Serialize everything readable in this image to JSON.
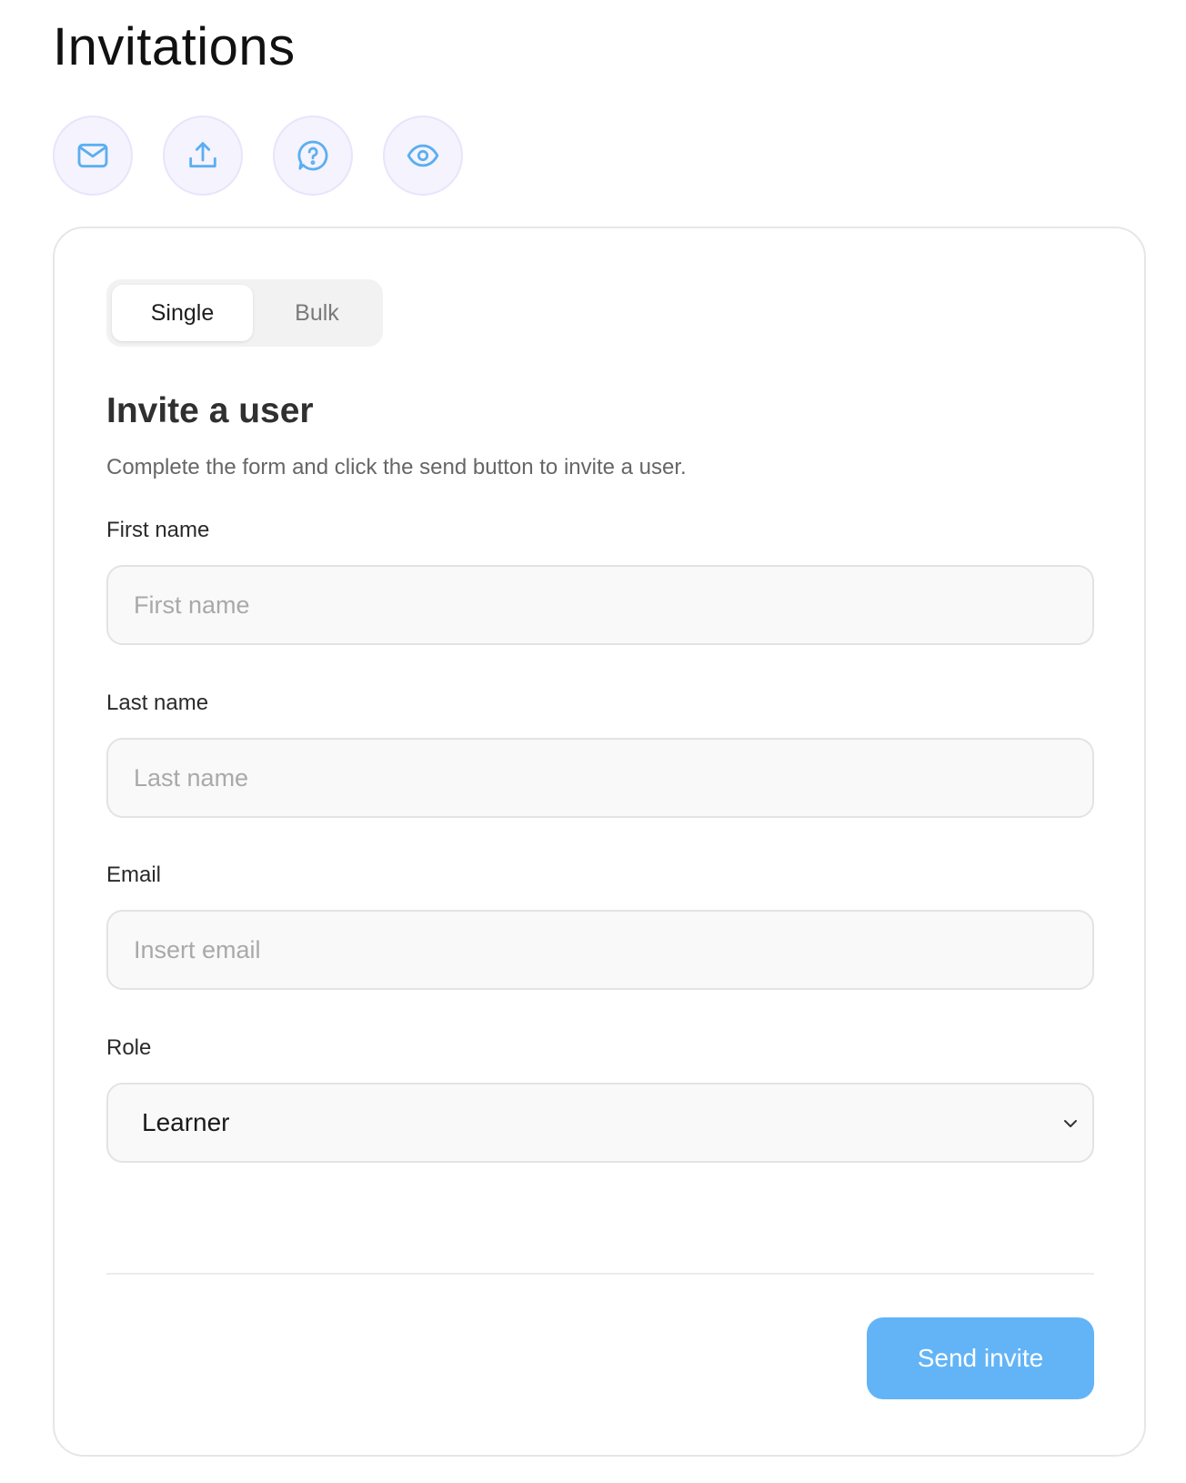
{
  "page": {
    "title": "Invitations"
  },
  "toolbar": {
    "icons": [
      {
        "name": "mail-icon"
      },
      {
        "name": "upload-icon"
      },
      {
        "name": "help-icon"
      },
      {
        "name": "eye-icon"
      }
    ],
    "icon_color": "#5aaff0",
    "icon_bg": "#f5f3fe"
  },
  "tabs": {
    "single_label": "Single",
    "bulk_label": "Bulk",
    "active": "Single"
  },
  "form": {
    "heading": "Invite a user",
    "description": "Complete the form and click the send button to invite a user.",
    "first_name": {
      "label": "First name",
      "placeholder": "First name",
      "value": ""
    },
    "last_name": {
      "label": "Last name",
      "placeholder": "Last name",
      "value": ""
    },
    "email": {
      "label": "Email",
      "placeholder": "Insert email",
      "value": ""
    },
    "role": {
      "label": "Role",
      "selected": "Learner"
    },
    "submit_label": "Send invite"
  },
  "colors": {
    "accent": "#62b4f7"
  }
}
